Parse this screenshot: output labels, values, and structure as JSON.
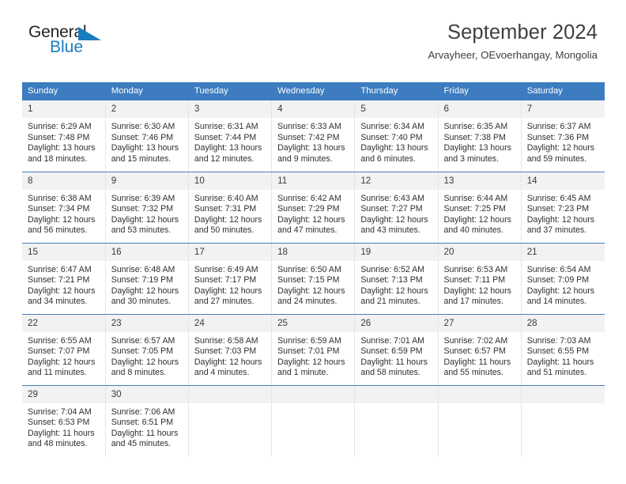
{
  "brand": {
    "name_part1": "General",
    "name_part2": "Blue",
    "triangle_color": "#1a7cc0",
    "text_color": "#231f20",
    "blue_color": "#1a7cc0"
  },
  "header": {
    "title": "September 2024",
    "subtitle": "Arvayheer, OEvoerhangay, Mongolia"
  },
  "calendar": {
    "accent_color": "#3c7cbf",
    "daynum_band_color": "#f2f2f2",
    "weekday_headers": [
      "Sunday",
      "Monday",
      "Tuesday",
      "Wednesday",
      "Thursday",
      "Friday",
      "Saturday"
    ],
    "weeks": [
      [
        {
          "day": "1",
          "sunrise": "Sunrise: 6:29 AM",
          "sunset": "Sunset: 7:48 PM",
          "daylight": "Daylight: 13 hours and 18 minutes."
        },
        {
          "day": "2",
          "sunrise": "Sunrise: 6:30 AM",
          "sunset": "Sunset: 7:46 PM",
          "daylight": "Daylight: 13 hours and 15 minutes."
        },
        {
          "day": "3",
          "sunrise": "Sunrise: 6:31 AM",
          "sunset": "Sunset: 7:44 PM",
          "daylight": "Daylight: 13 hours and 12 minutes."
        },
        {
          "day": "4",
          "sunrise": "Sunrise: 6:33 AM",
          "sunset": "Sunset: 7:42 PM",
          "daylight": "Daylight: 13 hours and 9 minutes."
        },
        {
          "day": "5",
          "sunrise": "Sunrise: 6:34 AM",
          "sunset": "Sunset: 7:40 PM",
          "daylight": "Daylight: 13 hours and 6 minutes."
        },
        {
          "day": "6",
          "sunrise": "Sunrise: 6:35 AM",
          "sunset": "Sunset: 7:38 PM",
          "daylight": "Daylight: 13 hours and 3 minutes."
        },
        {
          "day": "7",
          "sunrise": "Sunrise: 6:37 AM",
          "sunset": "Sunset: 7:36 PM",
          "daylight": "Daylight: 12 hours and 59 minutes."
        }
      ],
      [
        {
          "day": "8",
          "sunrise": "Sunrise: 6:38 AM",
          "sunset": "Sunset: 7:34 PM",
          "daylight": "Daylight: 12 hours and 56 minutes."
        },
        {
          "day": "9",
          "sunrise": "Sunrise: 6:39 AM",
          "sunset": "Sunset: 7:32 PM",
          "daylight": "Daylight: 12 hours and 53 minutes."
        },
        {
          "day": "10",
          "sunrise": "Sunrise: 6:40 AM",
          "sunset": "Sunset: 7:31 PM",
          "daylight": "Daylight: 12 hours and 50 minutes."
        },
        {
          "day": "11",
          "sunrise": "Sunrise: 6:42 AM",
          "sunset": "Sunset: 7:29 PM",
          "daylight": "Daylight: 12 hours and 47 minutes."
        },
        {
          "day": "12",
          "sunrise": "Sunrise: 6:43 AM",
          "sunset": "Sunset: 7:27 PM",
          "daylight": "Daylight: 12 hours and 43 minutes."
        },
        {
          "day": "13",
          "sunrise": "Sunrise: 6:44 AM",
          "sunset": "Sunset: 7:25 PM",
          "daylight": "Daylight: 12 hours and 40 minutes."
        },
        {
          "day": "14",
          "sunrise": "Sunrise: 6:45 AM",
          "sunset": "Sunset: 7:23 PM",
          "daylight": "Daylight: 12 hours and 37 minutes."
        }
      ],
      [
        {
          "day": "15",
          "sunrise": "Sunrise: 6:47 AM",
          "sunset": "Sunset: 7:21 PM",
          "daylight": "Daylight: 12 hours and 34 minutes."
        },
        {
          "day": "16",
          "sunrise": "Sunrise: 6:48 AM",
          "sunset": "Sunset: 7:19 PM",
          "daylight": "Daylight: 12 hours and 30 minutes."
        },
        {
          "day": "17",
          "sunrise": "Sunrise: 6:49 AM",
          "sunset": "Sunset: 7:17 PM",
          "daylight": "Daylight: 12 hours and 27 minutes."
        },
        {
          "day": "18",
          "sunrise": "Sunrise: 6:50 AM",
          "sunset": "Sunset: 7:15 PM",
          "daylight": "Daylight: 12 hours and 24 minutes."
        },
        {
          "day": "19",
          "sunrise": "Sunrise: 6:52 AM",
          "sunset": "Sunset: 7:13 PM",
          "daylight": "Daylight: 12 hours and 21 minutes."
        },
        {
          "day": "20",
          "sunrise": "Sunrise: 6:53 AM",
          "sunset": "Sunset: 7:11 PM",
          "daylight": "Daylight: 12 hours and 17 minutes."
        },
        {
          "day": "21",
          "sunrise": "Sunrise: 6:54 AM",
          "sunset": "Sunset: 7:09 PM",
          "daylight": "Daylight: 12 hours and 14 minutes."
        }
      ],
      [
        {
          "day": "22",
          "sunrise": "Sunrise: 6:55 AM",
          "sunset": "Sunset: 7:07 PM",
          "daylight": "Daylight: 12 hours and 11 minutes."
        },
        {
          "day": "23",
          "sunrise": "Sunrise: 6:57 AM",
          "sunset": "Sunset: 7:05 PM",
          "daylight": "Daylight: 12 hours and 8 minutes."
        },
        {
          "day": "24",
          "sunrise": "Sunrise: 6:58 AM",
          "sunset": "Sunset: 7:03 PM",
          "daylight": "Daylight: 12 hours and 4 minutes."
        },
        {
          "day": "25",
          "sunrise": "Sunrise: 6:59 AM",
          "sunset": "Sunset: 7:01 PM",
          "daylight": "Daylight: 12 hours and 1 minute."
        },
        {
          "day": "26",
          "sunrise": "Sunrise: 7:01 AM",
          "sunset": "Sunset: 6:59 PM",
          "daylight": "Daylight: 11 hours and 58 minutes."
        },
        {
          "day": "27",
          "sunrise": "Sunrise: 7:02 AM",
          "sunset": "Sunset: 6:57 PM",
          "daylight": "Daylight: 11 hours and 55 minutes."
        },
        {
          "day": "28",
          "sunrise": "Sunrise: 7:03 AM",
          "sunset": "Sunset: 6:55 PM",
          "daylight": "Daylight: 11 hours and 51 minutes."
        }
      ],
      [
        {
          "day": "29",
          "sunrise": "Sunrise: 7:04 AM",
          "sunset": "Sunset: 6:53 PM",
          "daylight": "Daylight: 11 hours and 48 minutes."
        },
        {
          "day": "30",
          "sunrise": "Sunrise: 7:06 AM",
          "sunset": "Sunset: 6:51 PM",
          "daylight": "Daylight: 11 hours and 45 minutes."
        },
        {
          "day": "",
          "sunrise": "",
          "sunset": "",
          "daylight": ""
        },
        {
          "day": "",
          "sunrise": "",
          "sunset": "",
          "daylight": ""
        },
        {
          "day": "",
          "sunrise": "",
          "sunset": "",
          "daylight": ""
        },
        {
          "day": "",
          "sunrise": "",
          "sunset": "",
          "daylight": ""
        },
        {
          "day": "",
          "sunrise": "",
          "sunset": "",
          "daylight": ""
        }
      ]
    ]
  }
}
